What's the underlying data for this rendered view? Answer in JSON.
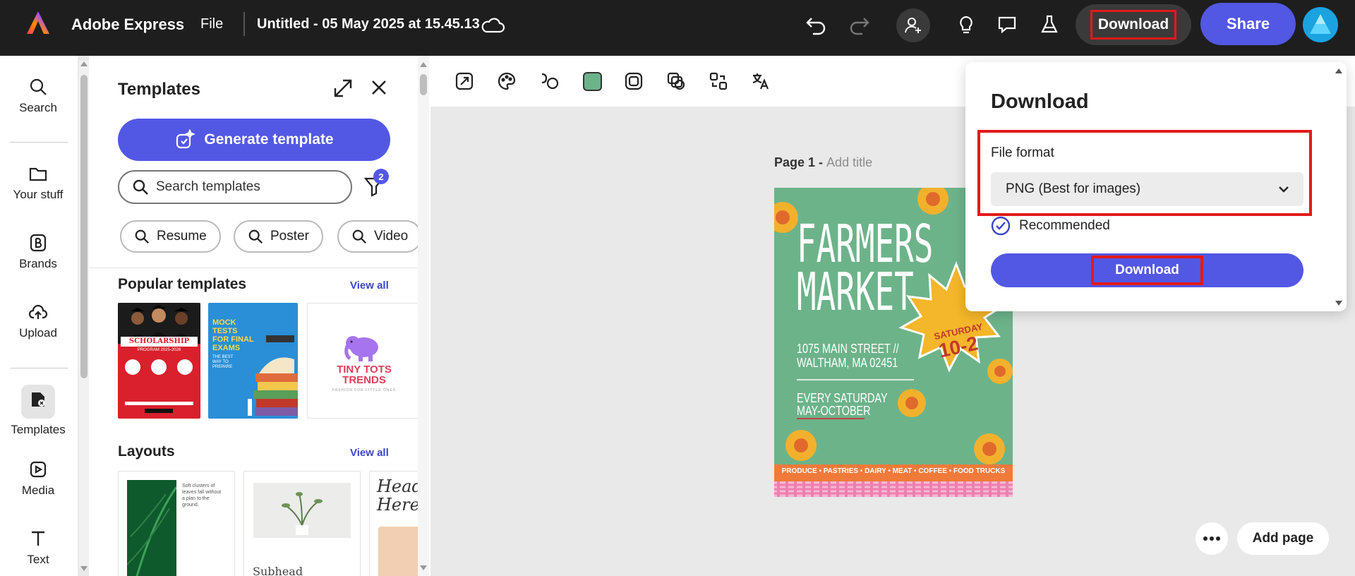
{
  "topbar": {
    "app_name": "Adobe Express",
    "file_menu": "File",
    "doc_title": "Untitled - 05 May 2025 at 15.45.13",
    "download_label": "Download",
    "share_label": "Share"
  },
  "rail": {
    "items": [
      {
        "label": "Search",
        "icon": "search-icon"
      },
      {
        "label": "Your stuff",
        "icon": "folder-icon"
      },
      {
        "label": "Brands",
        "icon": "brand-icon"
      },
      {
        "label": "Upload",
        "icon": "upload-icon"
      },
      {
        "label": "Templates",
        "icon": "templates-icon"
      },
      {
        "label": "Media",
        "icon": "media-icon"
      },
      {
        "label": "Text",
        "icon": "text-icon"
      }
    ]
  },
  "panel": {
    "title": "Templates",
    "generate_label": "Generate template",
    "search_placeholder": "Search templates",
    "filter_count": "2",
    "chips": [
      "Resume",
      "Poster",
      "Video"
    ],
    "popular_title": "Popular templates",
    "view_all": "View all",
    "layouts_title": "Layouts",
    "popular": [
      {
        "title": "SCHOLARSHIP",
        "subtitle": "PROGRAM 2025-2026"
      },
      {
        "title": "MOCK TESTS FOR FINAL EXAMS",
        "subtitle": "THE BEST WAY TO PREPARE"
      },
      {
        "title": "TINY TOTS TRENDS",
        "subtitle": "FASHION FOR LITTLE ONES"
      }
    ],
    "layouts": [
      {
        "text": "Soft clusters of leaves fall without a plan to the ground."
      },
      {
        "text": "Subhead"
      },
      {
        "text": "Head Here."
      }
    ]
  },
  "canvas": {
    "page_label": "Page 1 -",
    "add_title": "Add title",
    "add_page": "Add page"
  },
  "flyer": {
    "line1": "FARMERS",
    "line2": "MARKET",
    "address1": "1075 MAIN STREET //",
    "address2": "WALTHAM, MA 02451",
    "when1": "EVERY SATURDAY",
    "when2": "MAY-OCTOBER",
    "badge_top": "SATURDAY",
    "badge_time": "10-2",
    "footer": "PRODUCE • PASTRIES • DAIRY • MEAT • COFFEE • FOOD TRUCKS"
  },
  "download_popover": {
    "title": "Download",
    "format_label": "File format",
    "format_value": "PNG (Best for images)",
    "recommended": "Recommended",
    "button": "Download"
  },
  "colors": {
    "accent": "#5258e4",
    "highlight": "#e11a1a",
    "topbar": "#1e1e1e"
  }
}
